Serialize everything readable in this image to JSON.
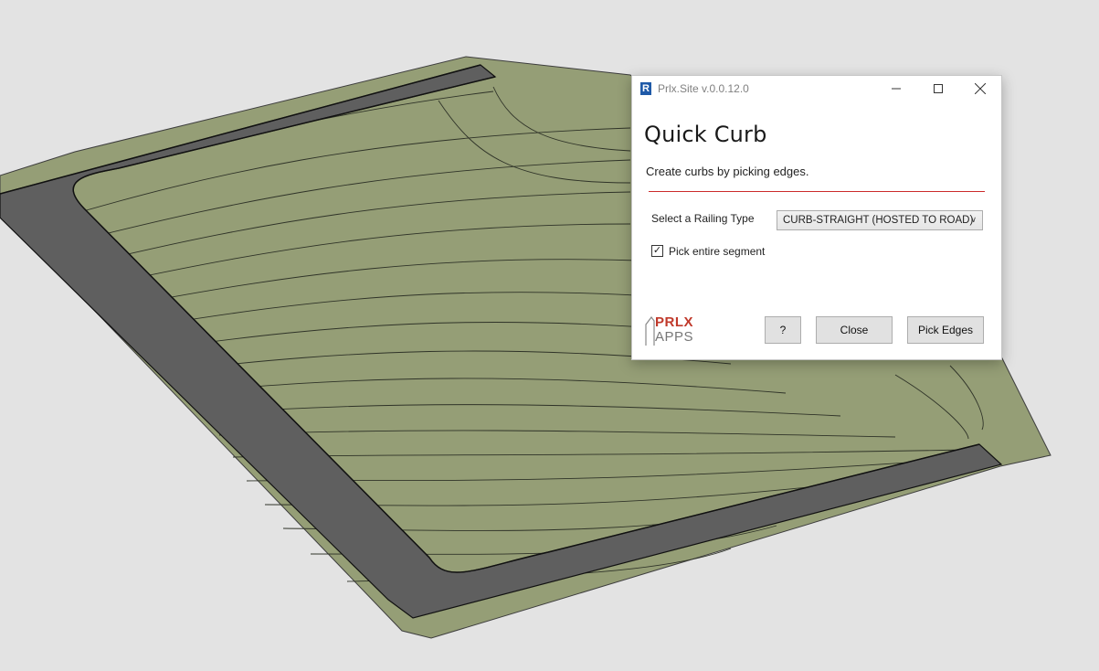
{
  "dialog": {
    "window_title": "Prlx.Site v.0.0.12.0",
    "app_icon": "R",
    "heading": "Quick Curb",
    "subtitle": "Create curbs by picking edges.",
    "railing_label": "Select a Railing Type",
    "railing_value": "CURB-STRAIGHT (HOSTED TO ROAD)",
    "pick_entire_label": "Pick entire segment",
    "pick_entire_checked": true,
    "logo_top": "PRLX",
    "logo_bottom": "APPS",
    "help_button": "?",
    "close_button": "Close",
    "pick_edges_button": "Pick Edges"
  },
  "icons": {
    "minimize": "minimize-icon",
    "maximize": "maximize-icon",
    "close": "close-icon",
    "dropdown": "chevron-down-icon",
    "check": "check-icon"
  },
  "colors": {
    "background": "#e3e3e3",
    "terrain": "#959e76",
    "road": "#5f5f5f",
    "accent_red": "#cc2a2a"
  }
}
